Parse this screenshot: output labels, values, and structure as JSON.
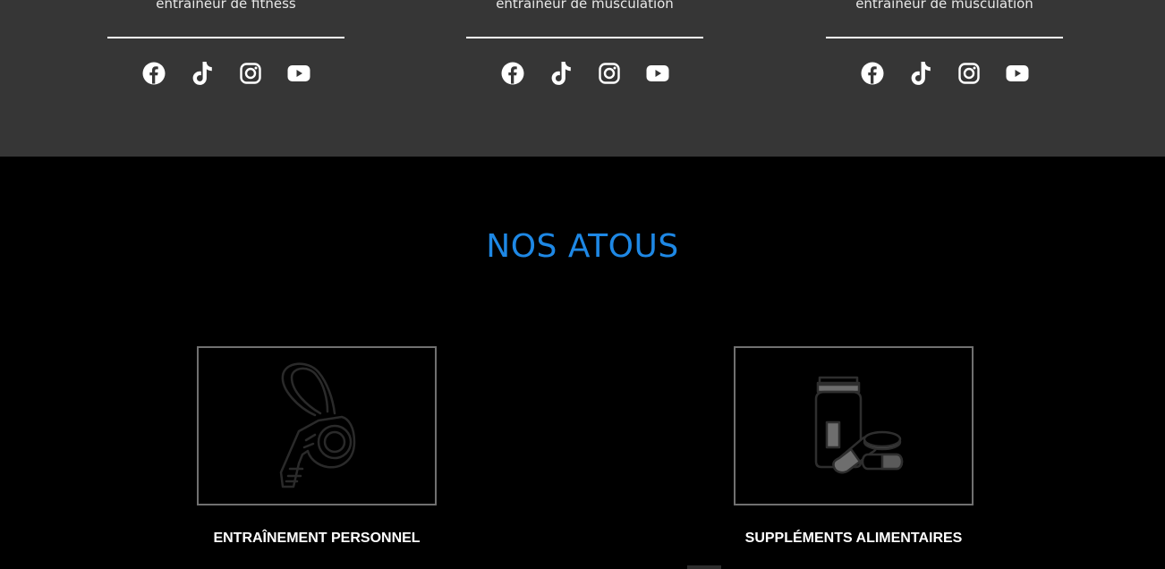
{
  "team": {
    "trainers": [
      {
        "role": "entraineur de fitness",
        "socials": [
          "facebook-icon",
          "tiktok-icon",
          "instagram-icon",
          "youtube-icon"
        ]
      },
      {
        "role": "entraineur de musculation",
        "socials": [
          "facebook-icon",
          "tiktok-icon",
          "instagram-icon",
          "youtube-icon"
        ]
      },
      {
        "role": "entraineur de musculation",
        "socials": [
          "facebook-icon",
          "tiktok-icon",
          "instagram-icon",
          "youtube-icon"
        ]
      }
    ]
  },
  "atous": {
    "title": "NOS ATOUS",
    "cards": [
      {
        "label": "ENTRAÎNEMENT PERSONNEL",
        "icon": "whistle-icon"
      },
      {
        "label": "SUPPLÉMENTS ALIMENTAIRES",
        "icon": "supplements-icon"
      }
    ]
  },
  "colors": {
    "team_bg": "#363636",
    "page_bg": "#000000",
    "accent_title": "#1e88e5",
    "card_border": "#707070",
    "text": "#ffffff"
  }
}
